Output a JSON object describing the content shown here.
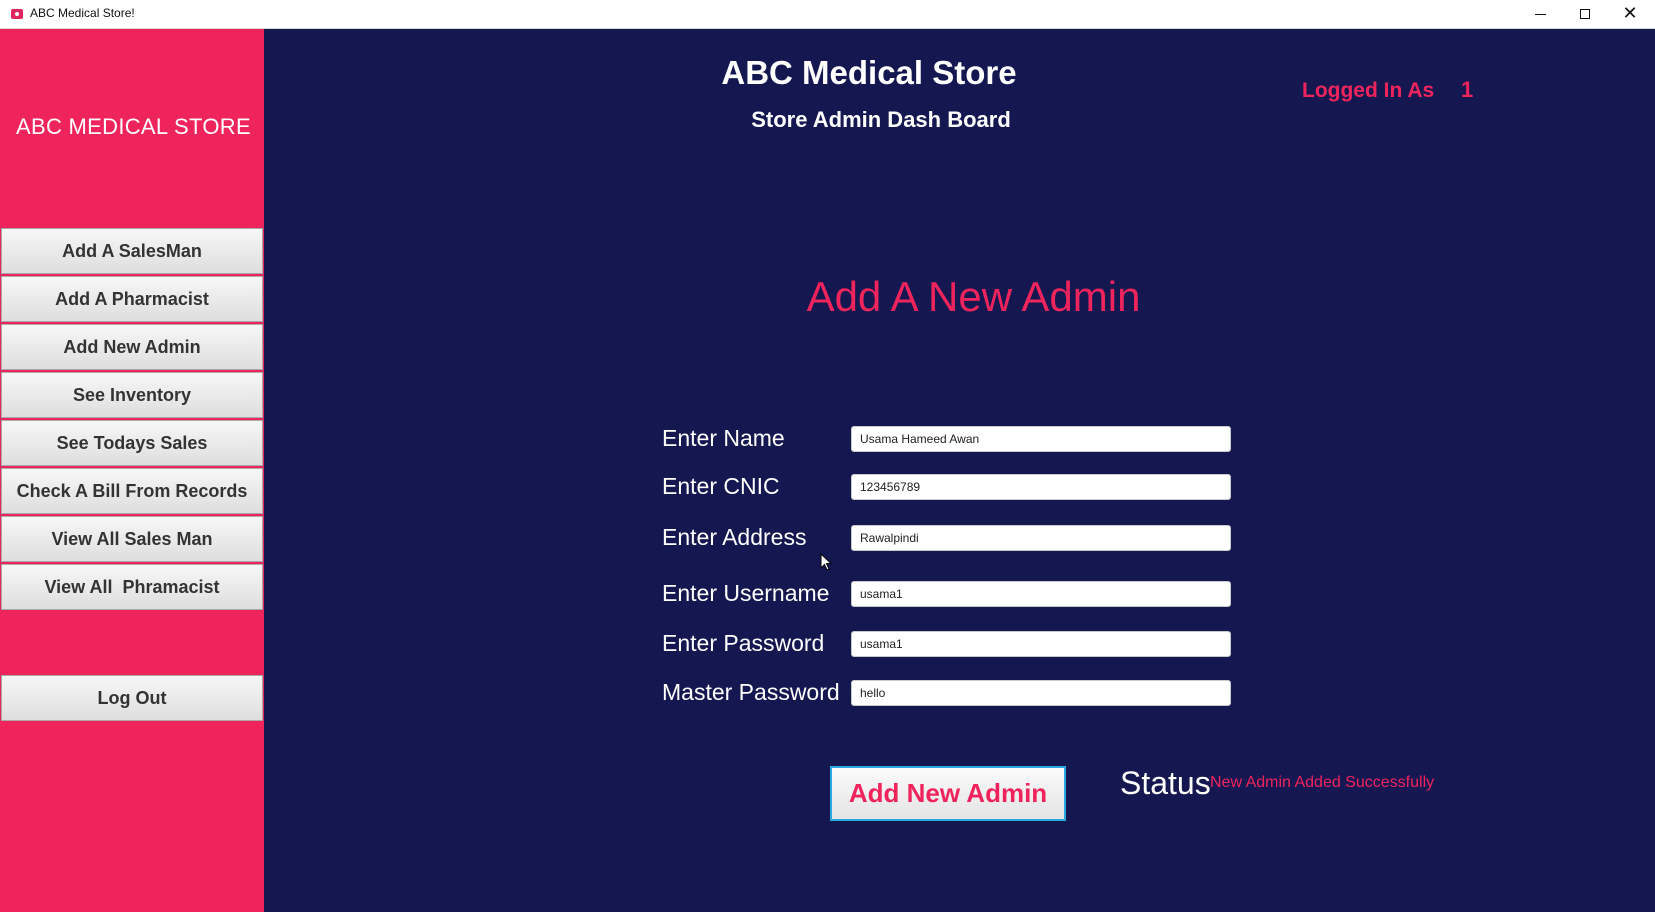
{
  "window": {
    "title": "ABC Medical Store!",
    "minimize_icon": "minimize-icon",
    "maximize_icon": "maximize-icon",
    "close_icon": "close-icon"
  },
  "sidebar": {
    "brand": "ABC MEDICAL STORE",
    "items": [
      {
        "label": "Add A SalesMan"
      },
      {
        "label": "Add A Pharmacist"
      },
      {
        "label": "Add New Admin"
      },
      {
        "label": "See Inventory"
      },
      {
        "label": "See Todays Sales"
      },
      {
        "label": "Check A Bill From Records"
      },
      {
        "label": "View All Sales Man"
      },
      {
        "label": "View All  Phramacist"
      }
    ],
    "logout_label": "Log Out"
  },
  "header": {
    "title": "ABC Medical Store",
    "subtitle": "Store Admin Dash Board",
    "logged_in_label": "Logged In As",
    "logged_in_value": "1"
  },
  "form": {
    "title": "Add A New Admin",
    "fields": [
      {
        "label": "Enter Name",
        "value": "Usama Hameed Awan"
      },
      {
        "label": "Enter CNIC",
        "value": "123456789"
      },
      {
        "label": "Enter Address",
        "value": "Rawalpindi"
      },
      {
        "label": "Enter Username",
        "value": "usama1"
      },
      {
        "label": "Enter Password",
        "value": "usama1"
      },
      {
        "label": "Master Password",
        "value": "hello"
      }
    ],
    "submit_label": "Add New Admin",
    "status_label": "Status",
    "status_message": "New Admin Added Successfully"
  },
  "colors": {
    "sidebar": "#ef245d",
    "main_bg": "#151750",
    "accent": "#ef245d"
  }
}
